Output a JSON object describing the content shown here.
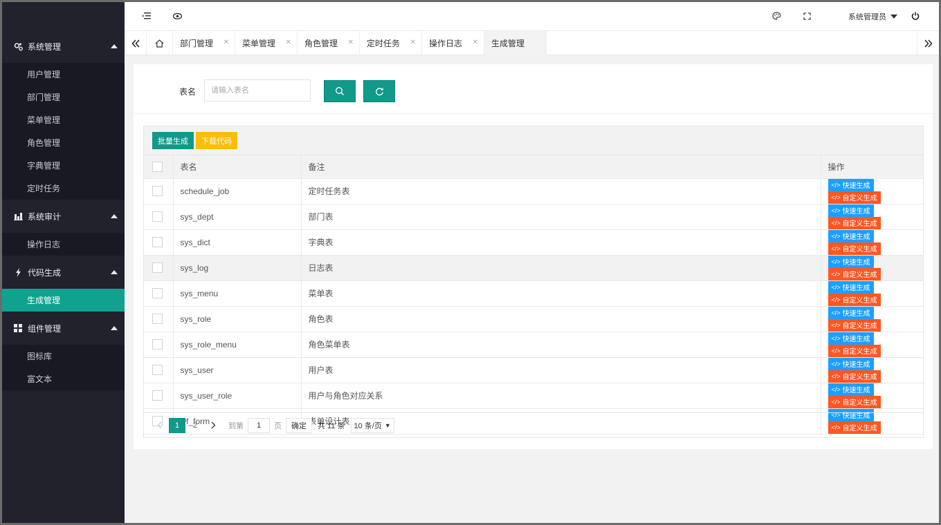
{
  "sidebar": {
    "groups": [
      {
        "label": "系统管理",
        "icon": "gears-icon",
        "items": [
          "用户管理",
          "部门管理",
          "菜单管理",
          "角色管理",
          "字典管理",
          "定时任务"
        ]
      },
      {
        "label": "系统审计",
        "icon": "chart-icon",
        "items": [
          "操作日志"
        ]
      },
      {
        "label": "代码生成",
        "icon": "bolt-icon",
        "items": [
          "生成管理"
        ]
      },
      {
        "label": "组件管理",
        "icon": "grid-icon",
        "items": [
          "图标库",
          "富文本"
        ]
      }
    ],
    "active_item": "生成管理"
  },
  "header": {
    "user_name": "系统管理员"
  },
  "tabs": [
    {
      "label": "部门管理"
    },
    {
      "label": "菜单管理"
    },
    {
      "label": "角色管理"
    },
    {
      "label": "定时任务"
    },
    {
      "label": "操作日志"
    },
    {
      "label": "生成管理",
      "active": true
    }
  ],
  "search": {
    "label": "表名",
    "placeholder": "请输入表名"
  },
  "toolbar": {
    "batch_label": "批量生成",
    "download_label": "下载代码"
  },
  "table": {
    "columns": [
      "表名",
      "备注",
      "操作"
    ],
    "rows": [
      {
        "name": "schedule_job",
        "comment": "定时任务表"
      },
      {
        "name": "sys_dept",
        "comment": "部门表"
      },
      {
        "name": "sys_dict",
        "comment": "字典表"
      },
      {
        "name": "sys_log",
        "comment": "日志表"
      },
      {
        "name": "sys_menu",
        "comment": "菜单表"
      },
      {
        "name": "sys_role",
        "comment": "角色表"
      },
      {
        "name": "sys_role_menu",
        "comment": "角色菜单表"
      },
      {
        "name": "sys_user",
        "comment": "用户表"
      },
      {
        "name": "sys_user_role",
        "comment": "用户与角色对应关系"
      },
      {
        "name": "wf_form",
        "comment": "表单设计表"
      }
    ],
    "quick_label": "快速生成",
    "custom_label": "自定义生成",
    "code_glyph": "</>"
  },
  "pager": {
    "pages": [
      "1",
      "2"
    ],
    "current": "1",
    "goto_prefix": "到第",
    "goto_value": "1",
    "goto_suffix": "页",
    "confirm": "确定",
    "total": "共 11 条",
    "page_size": "10 条/页"
  }
}
